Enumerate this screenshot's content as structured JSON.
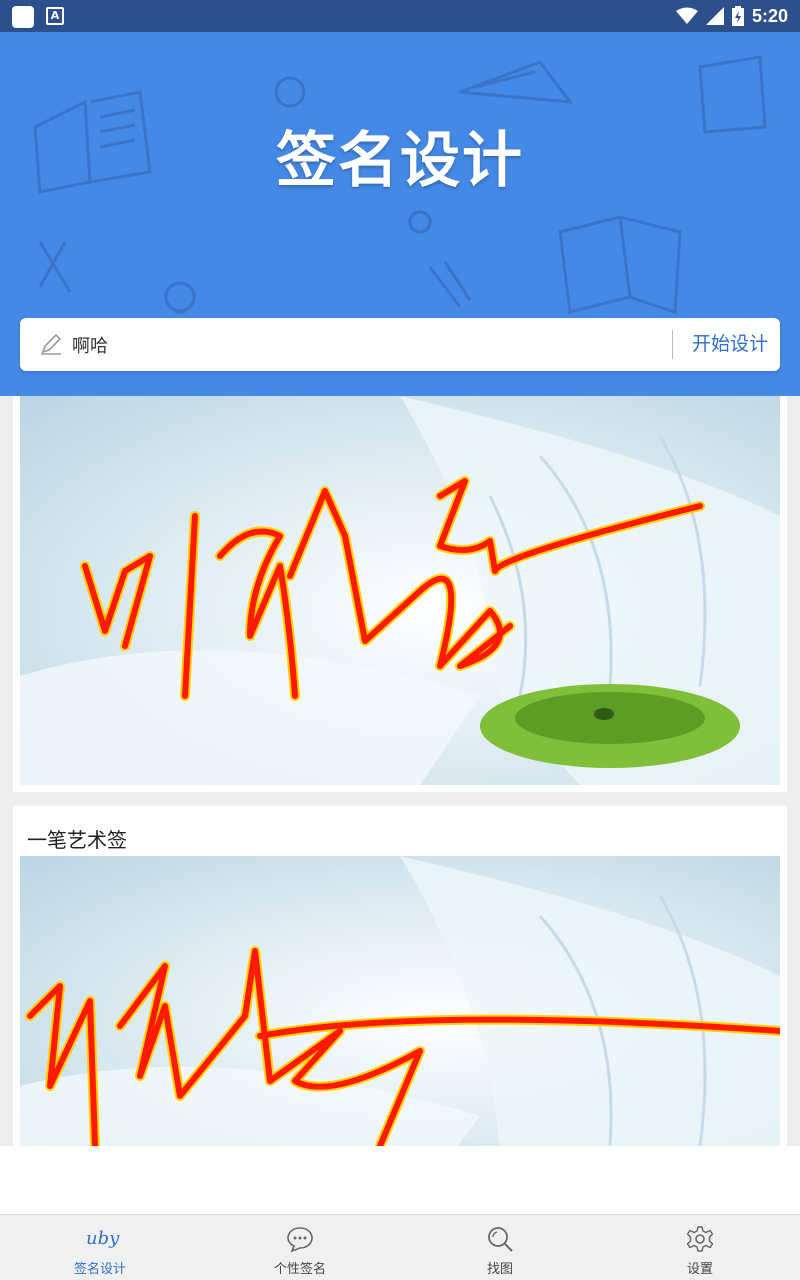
{
  "status_bar": {
    "time": "5:20"
  },
  "header": {
    "title": "签名设计"
  },
  "search": {
    "value": "啊哈",
    "start_label": "开始设计"
  },
  "cards": [
    {
      "title": ""
    },
    {
      "title": "一笔艺术签"
    }
  ],
  "nav": {
    "items": [
      {
        "label": "签名设计",
        "icon": "signature-icon",
        "active": true,
        "glyph": "uby"
      },
      {
        "label": "个性签名",
        "icon": "chat-bubble-icon",
        "active": false
      },
      {
        "label": "找图",
        "icon": "search-icon",
        "active": false
      },
      {
        "label": "设置",
        "icon": "gear-icon",
        "active": false
      }
    ]
  },
  "colors": {
    "header_bg": "#4589e6",
    "accent": "#2e6fd0",
    "signature": "#ff1a00"
  }
}
